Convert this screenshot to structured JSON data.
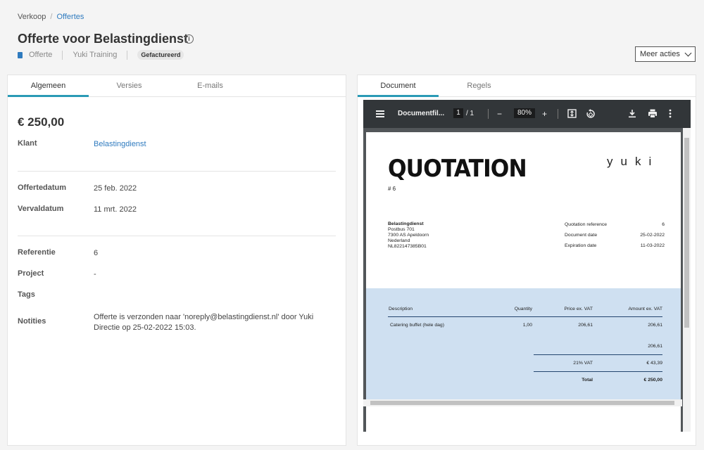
{
  "breadcrumb": {
    "root": "Verkoop",
    "current": "Offertes"
  },
  "title": "Offerte voor Belastingdienst",
  "meta": {
    "type": "Offerte",
    "company": "Yuki Training",
    "status": "Gefactureerd"
  },
  "actions": {
    "more_label": "Meer acties"
  },
  "left_tabs": [
    "Algemeen",
    "Versies",
    "E-mails"
  ],
  "right_tabs": [
    "Document",
    "Regels"
  ],
  "details": {
    "amount": "€ 250,00",
    "klant_label": "Klant",
    "klant_value": "Belastingdienst",
    "offertedatum_label": "Offertedatum",
    "offertedatum_value": "25 feb. 2022",
    "vervaldatum_label": "Vervaldatum",
    "vervaldatum_value": "11 mrt. 2022",
    "referentie_label": "Referentie",
    "referentie_value": "6",
    "project_label": "Project",
    "project_value": "-",
    "tags_label": "Tags",
    "notities_label": "Notities",
    "notities_value": "Offerte is verzonden naar 'noreply@belastingdienst.nl' door Yuki Directie op 25-02-2022 15:03."
  },
  "viewer": {
    "title": "Documentfil...",
    "page_current": "1",
    "page_total": "/  1",
    "zoom": "80%"
  },
  "pdf": {
    "heading": "QUOTATION",
    "number": "# 6",
    "logo": "yuki",
    "address": [
      "Belastingdienst",
      "Postbus 701",
      "7300 AS Apeldoorn",
      "Nederland",
      "NL822147385B01"
    ],
    "refs": [
      {
        "label": "Quotation reference",
        "value": "6"
      },
      {
        "label": "Document date",
        "value": "25-02-2022"
      },
      {
        "label": "Expiration date",
        "value": "11-03-2022"
      }
    ],
    "columns": [
      "Description",
      "Quantity",
      "Price ex. VAT",
      "Amount ex. VAT"
    ],
    "line": {
      "description": "Catering buffet (hele dag)",
      "quantity": "1,00",
      "price": "206,61",
      "amount": "206,61"
    },
    "subtotal": "206,61",
    "vat_label": "21% VAT",
    "vat_value": "€ 43,39",
    "total_label": "Total",
    "total_value": "€ 250,00"
  }
}
